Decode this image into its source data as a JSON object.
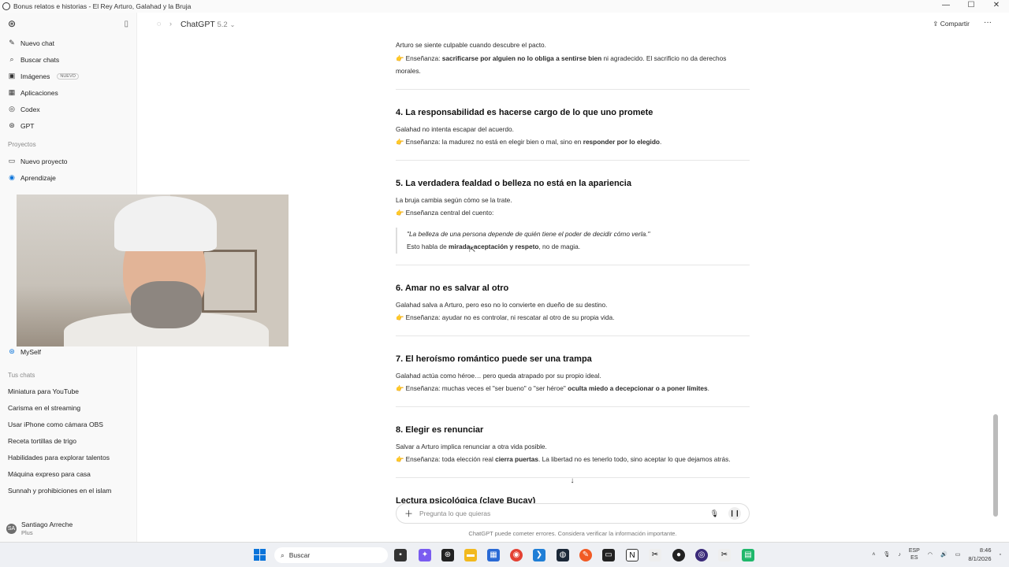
{
  "window": {
    "title": "Bonus relatos e historias - El Rey Arturo, Galahad y la Bruja",
    "minimize": "—",
    "maximize": "☐",
    "close": "✕"
  },
  "sidebar": {
    "top_items": [
      {
        "label": "Nuevo chat",
        "icon": "✎"
      },
      {
        "label": "Buscar chats",
        "icon": "⌕"
      },
      {
        "label": "Imágenes",
        "icon": "▣",
        "badge": "NUEVO"
      },
      {
        "label": "Aplicaciones",
        "icon": "▦"
      },
      {
        "label": "Codex",
        "icon": "◎"
      },
      {
        "label": "GPT",
        "icon": "⊛"
      }
    ],
    "projects_title": "Proyectos",
    "projects": [
      {
        "label": "Nuevo proyecto",
        "icon": "▭"
      },
      {
        "label": "Aprendizaje",
        "icon": "◉"
      }
    ],
    "extra_project": {
      "label": "MySelf",
      "icon": "⊛"
    },
    "chats_title": "Tus chats",
    "chats": [
      "Miniatura para YouTube",
      "Carisma en el streaming",
      "Usar iPhone como cámara OBS",
      "Receta tortillas de trigo",
      "Habilidades para explorar talentos",
      "Máquina expreso para casa",
      "Sunnah y prohibiciones en el islam"
    ],
    "user": {
      "name": "Santiago Arreche",
      "plan": "Plus",
      "initials": "SA"
    }
  },
  "topbar": {
    "model": "ChatGPT",
    "version": "5.2",
    "share_label": "Compartir"
  },
  "content": {
    "intro_line": "Arturo se siente culpable cuando descubre el pacto.",
    "intro_teaching_pre": "👉 Enseñanza: ",
    "intro_teaching_bold": "sacrificarse por alguien no lo obliga a sentirse bien",
    "intro_teaching_post": " ni agradecido. El sacrificio no da derechos morales.",
    "sections": [
      {
        "heading": "4. La responsabilidad es hacerse cargo de lo que uno promete",
        "line": "Galahad no intenta escapar del acuerdo.",
        "teaching_pre": "👉 Enseñanza: la madurez no está en elegir bien o mal, sino en ",
        "teaching_bold": "responder por lo elegido",
        "teaching_post": "."
      },
      {
        "heading": "5. La verdadera fealdad o belleza no está en la apariencia",
        "line": "La bruja cambia según cómo se la trate.",
        "teaching_pre": "👉 Enseñanza central del cuento:",
        "quote": "\"La belleza de una persona depende de quién tiene el poder de decidir cómo verla.\"",
        "quote_follow_pre": "Esto habla de ",
        "quote_follow_bold1": "mirada",
        "quote_follow_sep1": ", ",
        "quote_follow_bold2": "aceptación y respeto",
        "quote_follow_post": ", no de magia."
      },
      {
        "heading": "6. Amar no es salvar al otro",
        "line": "Galahad salva a Arturo, pero eso no lo convierte en dueño de su destino.",
        "teaching_pre": "👉 Enseñanza: ayudar no es controlar, ni rescatar al otro de su propia vida."
      },
      {
        "heading": "7. El heroísmo romántico puede ser una trampa",
        "line": "Galahad actúa como héroe… pero queda atrapado por su propio ideal.",
        "teaching_pre": "👉 Enseñanza: muchas veces el \"ser bueno\" o \"ser héroe\" ",
        "teaching_bold": "oculta miedo a decepcionar o a poner límites",
        "teaching_post": "."
      },
      {
        "heading": "8. Elegir es renunciar",
        "line": "Salvar a Arturo implica renunciar a otra vida posible.",
        "teaching_pre": "👉 Enseñanza: toda elección real ",
        "teaching_bold": "cierra puertas",
        "teaching_post": ". La libertad no es tenerlo todo, sino aceptar lo que dejamos atrás."
      }
    ],
    "next_heading": "Lectura psicológica (clave Bucay)"
  },
  "composer": {
    "placeholder": "Pregunta lo que quieras",
    "disclaimer": "ChatGPT puede cometer errores. Considera verificar la información importante."
  },
  "taskbar": {
    "search_label": "Buscar",
    "lang_top": "ESP",
    "lang_bottom": "ES",
    "time": "8:46",
    "date": "8/1/2026"
  }
}
